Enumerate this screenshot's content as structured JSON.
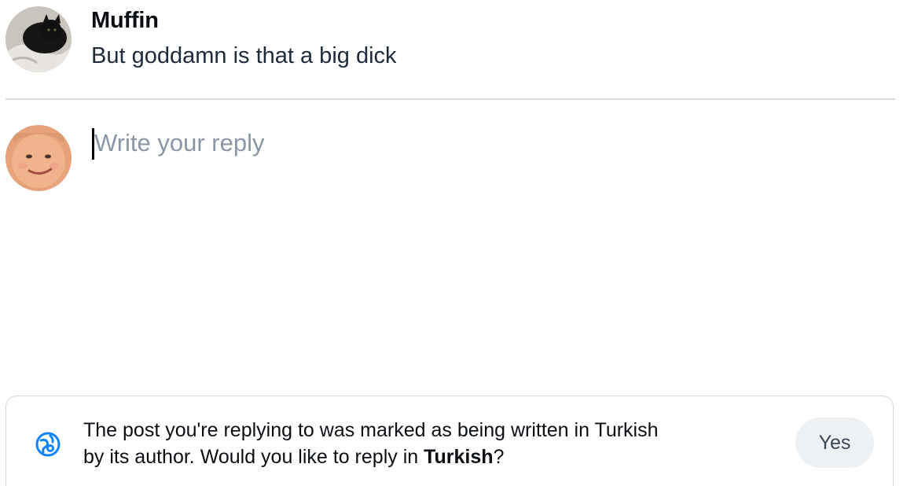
{
  "parent_post": {
    "author": "Muffin",
    "text": "But goddamn is that a big dick",
    "avatar_icon": "cat-avatar"
  },
  "composer": {
    "placeholder": "Write your reply",
    "avatar_icon": "user-avatar"
  },
  "language_prompt": {
    "icon": "language-icon",
    "text_before": "The post you're replying to was marked as being written in Turkish by its author. Would you like to reply in ",
    "language": "Turkish",
    "text_after": "?",
    "yes_label": "Yes"
  },
  "colors": {
    "accent": "#1083fe",
    "divider": "#d4dbe2",
    "button_bg": "#eef1f4",
    "placeholder": "#8a96a6"
  }
}
